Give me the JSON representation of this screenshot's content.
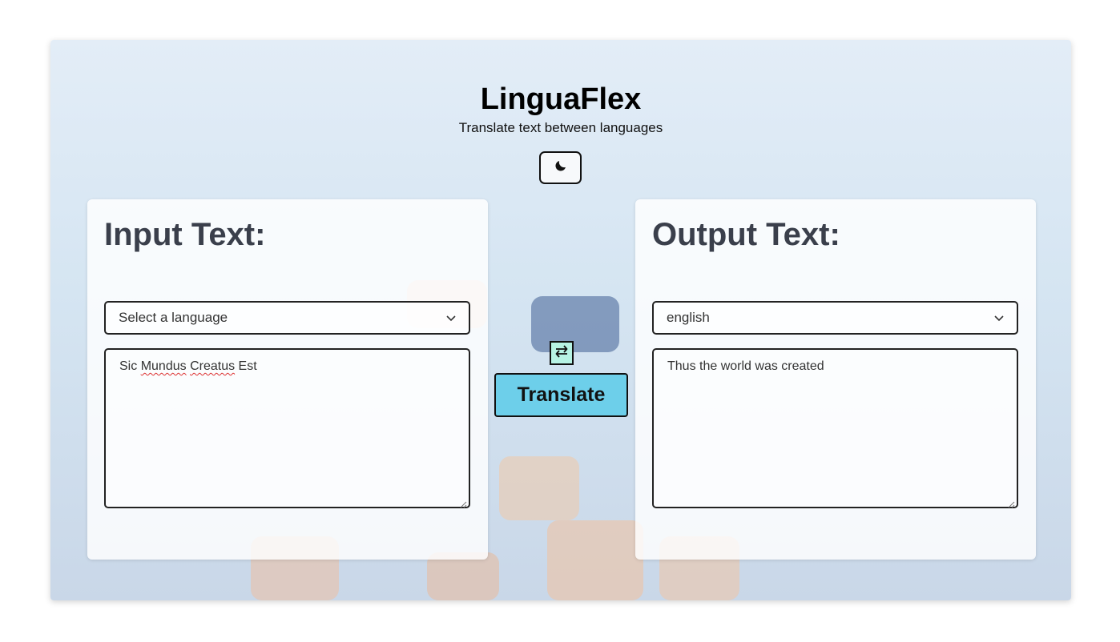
{
  "app": {
    "title": "LinguaFlex",
    "subtitle": "Translate text between languages"
  },
  "theme_toggle": {
    "icon": "moon-icon"
  },
  "input_panel": {
    "heading": "Input Text:",
    "language_selected": "Select a language",
    "text": "Sic Mundus Creatus Est"
  },
  "output_panel": {
    "heading": "Output Text:",
    "language_selected": "english",
    "text": "Thus the world was created"
  },
  "actions": {
    "swap_icon": "swap-arrows-icon",
    "translate_label": "Translate"
  },
  "colors": {
    "translate_button": "#6dcfea",
    "swap_button": "#b7f3e4",
    "heading_text": "#3a3f4b"
  }
}
